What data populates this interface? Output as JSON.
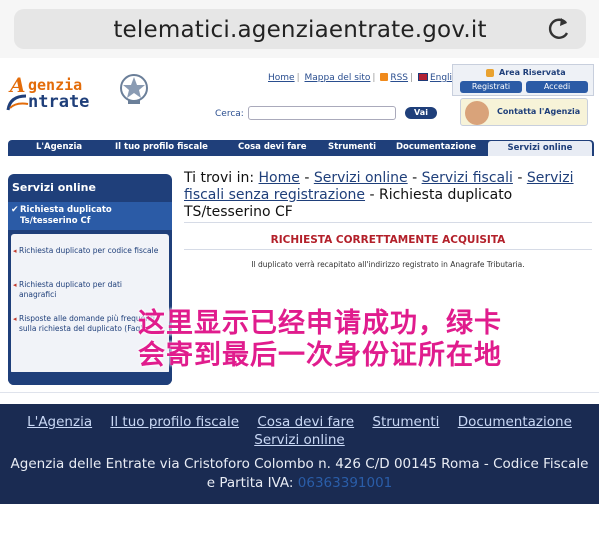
{
  "browser": {
    "url": "telematici.agenziaentrate.gov.it"
  },
  "header": {
    "logo_line1": "genzia",
    "logo_line2": "ntrate",
    "logo_initial": "A",
    "links": [
      "Home",
      "Mappa del sito",
      "RSS",
      "English"
    ],
    "search_label": "Cerca:",
    "search_placeholder": "",
    "search_button": "Vai",
    "area_title": "Area Riservata",
    "register": "Registrati",
    "login": "Accedi",
    "contact": "Contatta l'Agenzia"
  },
  "nav": {
    "items": [
      "L'Agenzia",
      "Il tuo profilo fiscale",
      "Cosa devi fare",
      "Strumenti",
      "Documentazione",
      "Servizi online"
    ]
  },
  "sidebar": {
    "title": "Servizi online",
    "active": "Richiesta duplicato Ts/tesserino Cf",
    "items": [
      "Richiesta duplicato per codice fiscale",
      "Richiesta duplicato per dati anagrafici",
      "Risposte alle domande più frequenti sulla richiesta del duplicato (Faq)"
    ]
  },
  "breadcrumb": {
    "prefix": "Ti trovi in:",
    "links": [
      "Home",
      "Servizi online",
      "Servizi fiscali",
      "Servizi fiscali senza registrazione"
    ],
    "current": "Richiesta duplicato TS/tesserino CF"
  },
  "content": {
    "success": "RICHIESTA CORRETTAMENTE ACQUISITA",
    "message": "Il duplicato verrà recapitato all'indirizzo registrato in Anagrafe Tributaria.",
    "overlay_line1": "这里显示已经申请成功，绿卡",
    "overlay_line2": "会寄到最后一次身份证所在地"
  },
  "footer": {
    "links": [
      "L'Agenzia",
      "Il tuo profilo fiscale",
      "Cosa devi fare",
      "Strumenti",
      "Documentazione"
    ],
    "links2": [
      "Servizi online"
    ],
    "address": "Agenzia delle Entrate via Cristoforo Colombo n. 426 C/D 00145 Roma - Codice Fiscale",
    "piva_label": "e Partita IVA:",
    "piva": "06363391001"
  },
  "colors": {
    "navy": "#1f3f7a",
    "accent_red": "#b3202a",
    "overlay_pink": "#e01c8d",
    "footer_bg": "#1a2b52"
  }
}
